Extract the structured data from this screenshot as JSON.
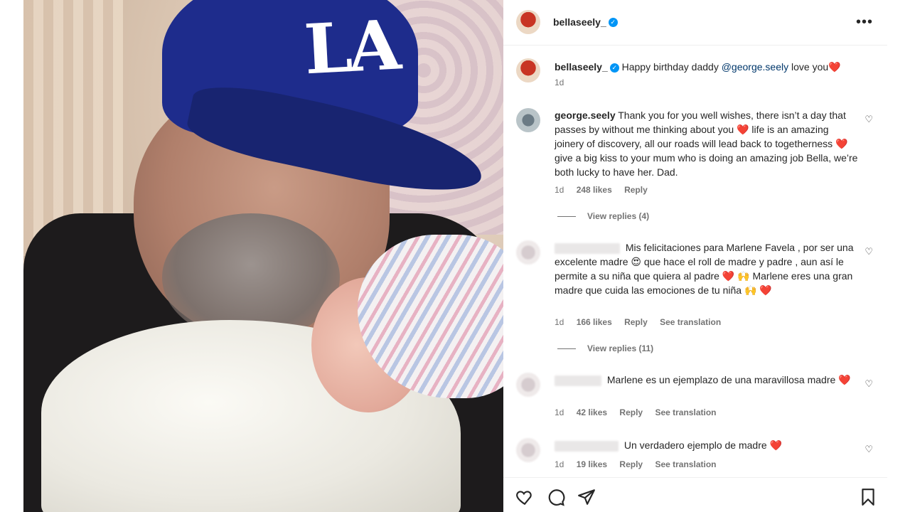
{
  "post": {
    "owner": "bellaseely_",
    "more_icon": "more-dots-icon",
    "caption": {
      "username": "bellaseely_",
      "text": "Happy birthday daddy ",
      "mention": "@george.seely",
      "text_after": " love you",
      "emoji": "❤️",
      "time": "1d"
    }
  },
  "photo": {
    "cap_logo": "LA"
  },
  "comments": [
    {
      "username": "george.seely",
      "text": "Thank you for you well wishes, there isn’t a day that passes by without me thinking about you ❤️ life is an amazing joinery of discovery, all our roads will lead back to togetherness ❤️ give a big kiss to your mum who is doing an amazing job Bella, we’re both lucky to have her. Dad.",
      "time": "1d",
      "likes": "248 likes",
      "reply": "Reply",
      "view_replies": "View replies (4)"
    },
    {
      "text": "Mis felicitaciones para Marlene Favela , por ser una excelente madre 😍 que hace el roll de madre y padre , aun así le permite a su niña que quiera al padre ❤️ 🙌 Marlene eres una gran madre que cuida las emociones de tu niña 🙌 ❤️",
      "time": "1d",
      "likes": "166 likes",
      "reply": "Reply",
      "translate": "See translation",
      "view_replies": "View replies (11)"
    },
    {
      "text": "Marlene es un ejemplazo de una maravillosa madre ❤️",
      "time": "1d",
      "likes": "42 likes",
      "reply": "Reply",
      "translate": "See translation"
    },
    {
      "text": "Un verdadero ejemplo de madre ❤️",
      "time": "1d",
      "likes": "19 likes",
      "reply": "Reply",
      "translate": "See translation"
    }
  ],
  "actions": [
    "heart-icon",
    "comment-icon",
    "share-icon",
    "bookmark-icon"
  ],
  "colors": {
    "verified": "#0095f6",
    "mention": "#00376b",
    "meta_text": "#737373",
    "heart_red": "#ed4956"
  }
}
